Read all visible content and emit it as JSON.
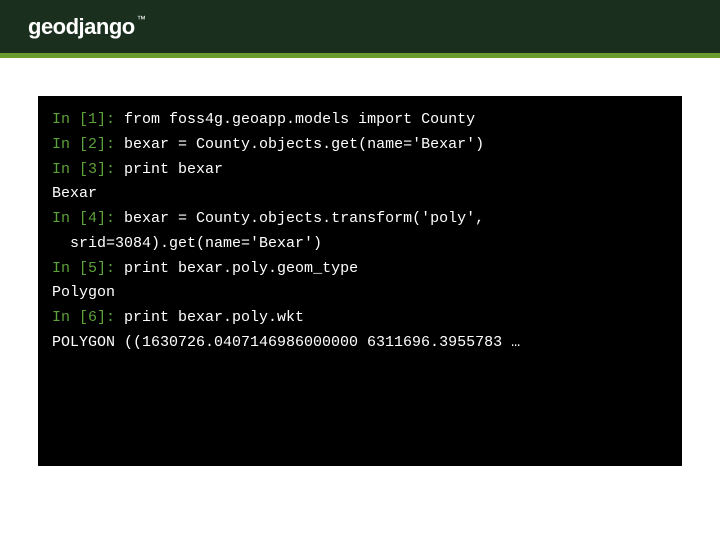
{
  "header": {
    "brand": "geodjango",
    "trademark": "™"
  },
  "terminal": {
    "lines": [
      {
        "prompt_in": "In ",
        "prompt_num": "[1]:",
        "code": " from foss4g.geoapp.models import County"
      },
      {
        "prompt_in": "In ",
        "prompt_num": "[2]:",
        "code": " bexar = County.objects.get(name='Bexar')"
      },
      {
        "prompt_in": "In ",
        "prompt_num": "[3]:",
        "code": " print bexar"
      },
      {
        "output": "Bexar"
      },
      {
        "prompt_in": "In ",
        "prompt_num": "[4]:",
        "code": " bexar = County.objects.transform('poly',"
      },
      {
        "continuation": "srid=3084).get(name='Bexar')"
      },
      {
        "prompt_in": "In ",
        "prompt_num": "[5]:",
        "code": " print bexar.poly.geom_type"
      },
      {
        "output": "Polygon"
      },
      {
        "prompt_in": "In ",
        "prompt_num": "[6]:",
        "code": " print bexar.poly.wkt"
      },
      {
        "output": "POLYGON ((1630726.0407146986000000 6311696.3955783 …"
      }
    ]
  }
}
